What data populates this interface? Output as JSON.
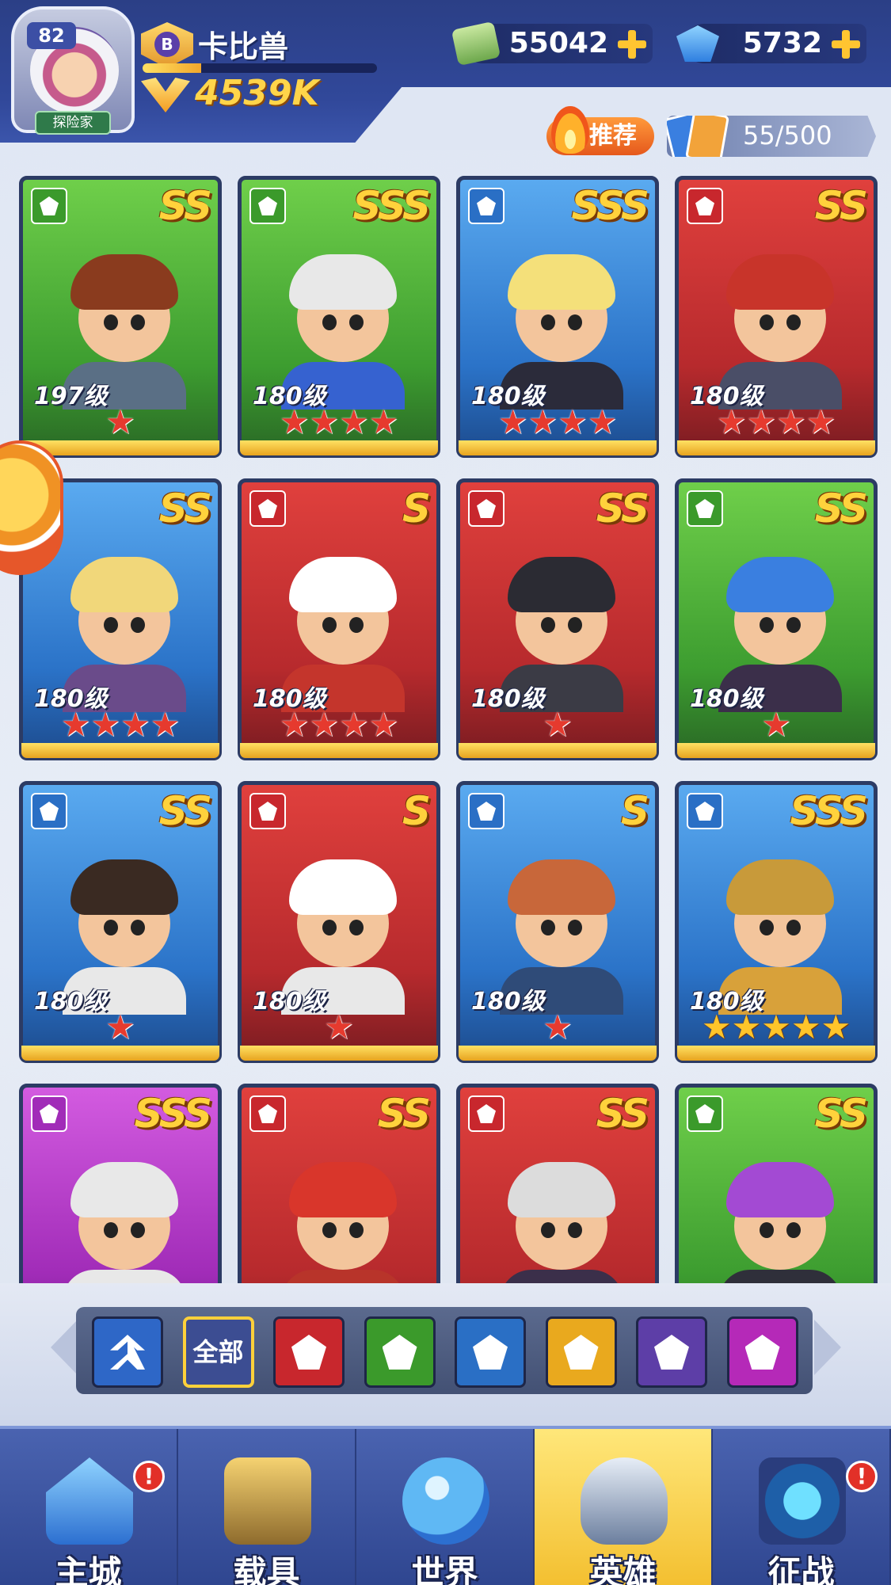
{
  "player": {
    "level": "82",
    "title_tag": "探险家",
    "rank_letter": "B",
    "name": "卡比兽",
    "exp_fraction": 0.25,
    "power": "4539K"
  },
  "currencies": {
    "money": "55042",
    "gems": "5732"
  },
  "header_actions": {
    "recommend_label": "推荐",
    "hero_count": "55/500"
  },
  "heroes": [
    {
      "rank": "SS",
      "level": "197级",
      "stars": 1,
      "star_color": "red",
      "color": "green",
      "faction": "green"
    },
    {
      "rank": "SSS",
      "level": "180级",
      "stars": 4,
      "star_color": "red",
      "color": "green",
      "faction": "green"
    },
    {
      "rank": "SSS",
      "level": "180级",
      "stars": 4,
      "star_color": "red",
      "color": "blue",
      "faction": "blue"
    },
    {
      "rank": "SS",
      "level": "180级",
      "stars": 4,
      "star_color": "red",
      "color": "red",
      "faction": "red"
    },
    {
      "rank": "SS",
      "level": "180级",
      "stars": 4,
      "star_color": "red",
      "color": "blue",
      "faction": "none"
    },
    {
      "rank": "S",
      "level": "180级",
      "stars": 4,
      "star_color": "red",
      "color": "red",
      "faction": "red"
    },
    {
      "rank": "SS",
      "level": "180级",
      "stars": 1,
      "star_color": "red",
      "color": "red",
      "faction": "red"
    },
    {
      "rank": "SS",
      "level": "180级",
      "stars": 1,
      "star_color": "red",
      "color": "green",
      "faction": "green"
    },
    {
      "rank": "SS",
      "level": "180级",
      "stars": 1,
      "star_color": "red",
      "color": "blue",
      "faction": "blue"
    },
    {
      "rank": "S",
      "level": "180级",
      "stars": 1,
      "star_color": "red",
      "color": "red",
      "faction": "red"
    },
    {
      "rank": "S",
      "level": "180级",
      "stars": 1,
      "star_color": "red",
      "color": "blue",
      "faction": "blue"
    },
    {
      "rank": "SSS",
      "level": "180级",
      "stars": 5,
      "star_color": "gold",
      "color": "blue",
      "faction": "blue"
    },
    {
      "rank": "SSS",
      "level": "",
      "stars": 0,
      "star_color": "red",
      "color": "purple",
      "faction": "purple"
    },
    {
      "rank": "SS",
      "level": "",
      "stars": 0,
      "star_color": "red",
      "color": "red",
      "faction": "red"
    },
    {
      "rank": "SS",
      "level": "",
      "stars": 0,
      "star_color": "red",
      "color": "red",
      "faction": "red"
    },
    {
      "rank": "SS",
      "level": "",
      "stars": 0,
      "star_color": "red",
      "color": "green",
      "faction": "green"
    }
  ],
  "filters": [
    {
      "id": "upgrade",
      "label": "",
      "icon": "chevron-up-icon"
    },
    {
      "id": "all",
      "label": "全部",
      "icon": "",
      "selected": true
    },
    {
      "id": "red",
      "label": "",
      "icon": "red-faction-icon"
    },
    {
      "id": "green",
      "label": "",
      "icon": "green-faction-icon"
    },
    {
      "id": "blue",
      "label": "",
      "icon": "blue-faction-icon"
    },
    {
      "id": "gold",
      "label": "",
      "icon": "gold-faction-icon"
    },
    {
      "id": "violet",
      "label": "",
      "icon": "violet-faction-icon"
    },
    {
      "id": "magenta",
      "label": "",
      "icon": "magenta-faction-icon"
    }
  ],
  "nav": [
    {
      "label": "主城",
      "alert": "!"
    },
    {
      "label": "载具",
      "alert": ""
    },
    {
      "label": "世界",
      "alert": ""
    },
    {
      "label": "英雄",
      "alert": "",
      "active": true
    },
    {
      "label": "征战",
      "alert": "!"
    }
  ],
  "colors": {
    "red": "#c8272d",
    "green": "#3b9a2b",
    "blue": "#2a6fc5",
    "purple": "#a12cb8",
    "gold": "#ffd23c"
  }
}
